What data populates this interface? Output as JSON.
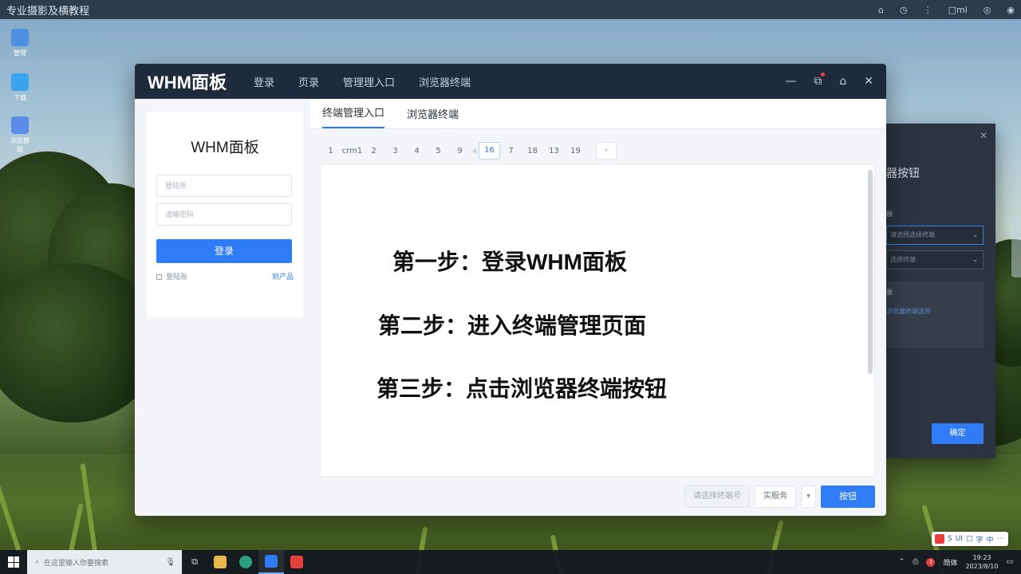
{
  "topbar": {
    "title": "专业摄影及横教程",
    "controls": [
      "⌂",
      "◷",
      "⋮",
      "□ml",
      "◎",
      "◉"
    ]
  },
  "desktop_icons": [
    {
      "name": "desktop-icon-1",
      "label": "管理",
      "color": "#4d8fe0"
    },
    {
      "name": "desktop-icon-2",
      "label": "下载",
      "color": "#3aa4f0"
    },
    {
      "name": "desktop-icon-3",
      "label": "浏览器助",
      "color": "#5b8de8"
    }
  ],
  "window": {
    "title": "WHM面板",
    "nav": [
      "登录",
      "页录",
      "管理理入口",
      "浏览器终端"
    ],
    "controls": {
      "minimize": "—",
      "screen": "⧉",
      "home": "⌂",
      "close": "✕"
    }
  },
  "login": {
    "title": "WHM面板",
    "username_placeholder": "登陆账",
    "password_placeholder": "请输密码",
    "login_button": "登录",
    "remember_label": "登陆账",
    "forgot_link": "到产品"
  },
  "tabs": [
    {
      "label": "终端管理入口",
      "active": true
    },
    {
      "label": "浏览器终端",
      "active": false
    }
  ],
  "pager": {
    "items": [
      {
        "label": "1"
      },
      {
        "label": "crm1"
      },
      {
        "label": "2"
      },
      {
        "label": "3"
      },
      {
        "label": "4"
      },
      {
        "label": "5"
      },
      {
        "label": "9"
      },
      {
        "label": "4",
        "small": true
      },
      {
        "label": "16",
        "selected": true
      },
      {
        "label": "7"
      },
      {
        "label": "18"
      },
      {
        "label": "13"
      },
      {
        "label": "19"
      }
    ],
    "next": "›"
  },
  "steps": [
    "第一步：登录WHM面板",
    "第二步：进入终端管理页面",
    "第三步：点击浏览器终端按钮"
  ],
  "footer": {
    "grey_button": "请选择终端号",
    "select_value": "实服务",
    "dropdown_arrow": "▾",
    "primary_button": "按钮"
  },
  "bg_window": {
    "close": "✕",
    "heading": "器按钮",
    "label1": "器",
    "select1": "请选择选择终端",
    "select2": "选择终端",
    "box_title": "量",
    "box_link": "浏览器终端选项",
    "ok_button": "确定"
  },
  "taskbar": {
    "search_placeholder": "在这里输入你要搜索",
    "tray_lang": "简体",
    "tray_badge": "2",
    "clock_time": "19:23",
    "clock_date": "2023/8/10"
  },
  "ime": {
    "items": [
      "S",
      "UI",
      "□",
      "字",
      "中",
      "⋯"
    ]
  }
}
